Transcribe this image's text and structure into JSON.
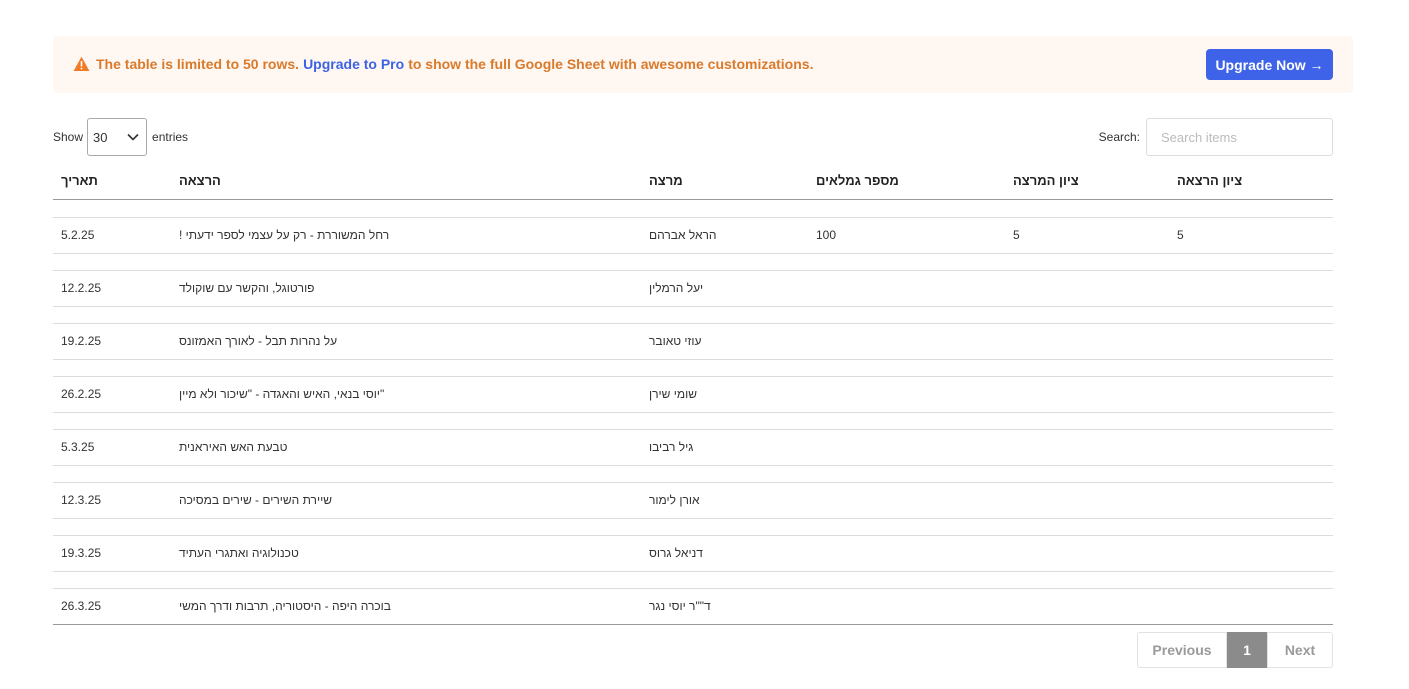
{
  "banner": {
    "text_before": "The table is limited to 50 rows.",
    "link": "Upgrade to Pro",
    "text_after": "to show the full Google Sheet with awesome customizations.",
    "button": "Upgrade Now →",
    "accent_color": "#d97a2c",
    "button_color": "#3e63e8"
  },
  "controls": {
    "show_label": "Show",
    "entries_value": "30",
    "entries_label": "entries",
    "search_label": "Search:",
    "search_placeholder": "Search items"
  },
  "table": {
    "headers": [
      "תאריך",
      "הרצאה",
      "מרצה",
      "מספר גמלאים",
      "ציון המרצה",
      "ציון הרצאה"
    ],
    "rows": [
      [
        "5.2.25",
        "רחל המשוררת - רק על עצמי לספר ידעתי !",
        "הראל אברהם",
        "100",
        "5",
        "5"
      ],
      [
        "12.2.25",
        "פורטוגל, והקשר עם שוקולד",
        "יעל הרמלין",
        "",
        "",
        ""
      ],
      [
        "19.2.25",
        "על נהרות תבל - לאורך האמזונס",
        "עוזי טאובר",
        "",
        "",
        ""
      ],
      [
        "26.2.25",
        "\"יוסי בנאי, האיש והאגדה - \"שיכור ולא מיין",
        "שומי שירן",
        "",
        "",
        ""
      ],
      [
        "5.3.25",
        "טבעת האש האיראנית",
        "גיל רביבו",
        "",
        "",
        ""
      ],
      [
        "12.3.25",
        "שיירת השירים - שירים במסיכה",
        "אורן לימור",
        "",
        "",
        ""
      ],
      [
        "19.3.25",
        "טכנולוגיה ואתגרי העתיד",
        "דניאל גרוס",
        "",
        "",
        ""
      ],
      [
        "26.3.25",
        "בוכרה היפה - היסטוריה, תרבות ודרך המשי",
        "ד\"\"ר יוסי נגר",
        "",
        "",
        ""
      ]
    ]
  },
  "pagination": {
    "previous": "Previous",
    "current": "1",
    "next": "Next"
  }
}
